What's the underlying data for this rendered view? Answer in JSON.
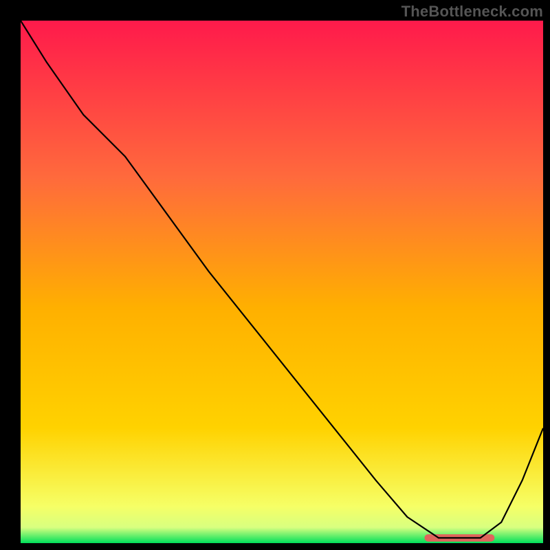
{
  "watermark": "TheBottleneck.com",
  "chart_data": {
    "type": "line",
    "title": "",
    "xlabel": "",
    "ylabel": "",
    "xlim": [
      0,
      100
    ],
    "ylim": [
      0,
      100
    ],
    "grid": false,
    "background": {
      "top_color": "#ff1a4b",
      "mid_color": "#ffd200",
      "bottom_green": "#00e05a",
      "bottom_bar_fraction": 0.025
    },
    "series": [
      {
        "name": "bottleneck-curve",
        "color": "#000000",
        "x": [
          0,
          5,
          12,
          20,
          28,
          36,
          44,
          52,
          60,
          68,
          74,
          80,
          84,
          88,
          92,
          96,
          100
        ],
        "y": [
          100,
          92,
          82,
          74,
          63,
          52,
          42,
          32,
          22,
          12,
          5,
          1,
          1,
          1,
          4,
          12,
          22
        ]
      }
    ],
    "flat_region": {
      "name": "optimal-range",
      "color": "#e0645c",
      "x_start": 78,
      "x_end": 90,
      "y": 1,
      "thickness": 8
    }
  }
}
